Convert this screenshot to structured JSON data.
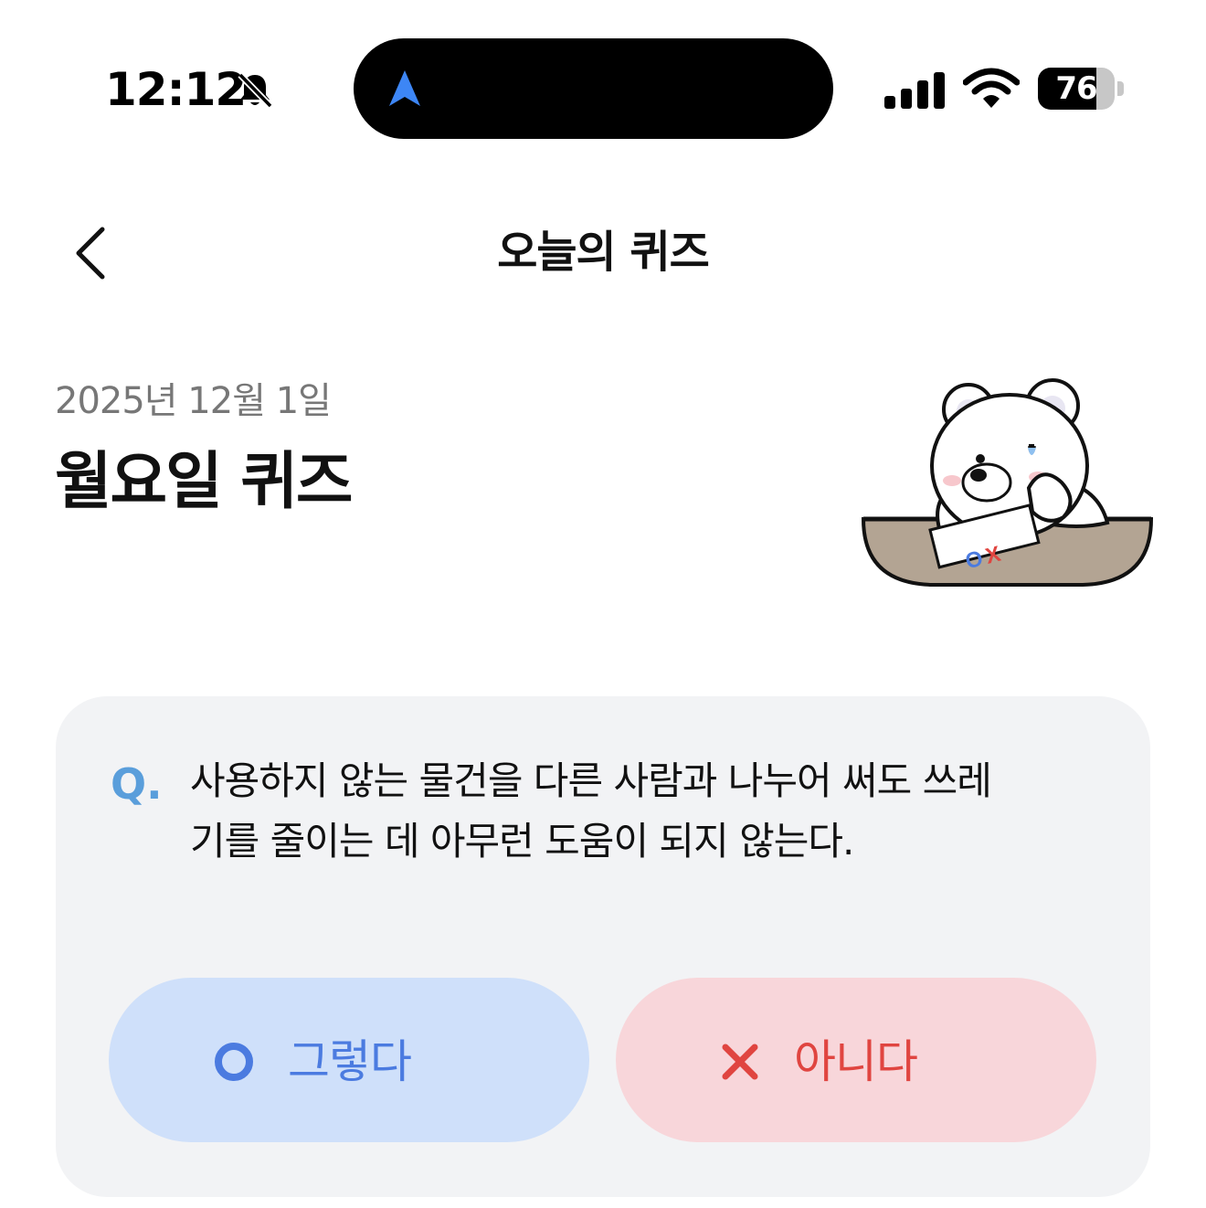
{
  "status_bar": {
    "time": "12:12",
    "battery_percent": "76",
    "battery_level": 0.76
  },
  "header": {
    "title": "오늘의 퀴즈"
  },
  "quiz": {
    "date": "2025년 12월 1일",
    "title": "월요일 퀴즈",
    "question_prefix": "Q.",
    "question": "사용하지 않는 물건을 다른 사람과 나누어 써도 쓰레기를 줄이는 데 아무런 도움이 되지 않는다.",
    "mascot_sign_text": "OX"
  },
  "answers": {
    "yes_label": "그렇다",
    "no_label": "아니다"
  },
  "colors": {
    "yes_bg": "#cfe0fa",
    "yes_accent": "#4b7be0",
    "no_bg": "#f8d6da",
    "no_accent": "#e04540",
    "q_accent": "#5a9edb",
    "card_bg": "#f2f3f5"
  },
  "icons": {
    "status": [
      "bell-slash-icon",
      "navigation-arrow-icon",
      "cellular-signal-icon",
      "wifi-icon",
      "battery-icon"
    ],
    "back": "chevron-left-icon",
    "yes": "circle-o-icon",
    "no": "x-mark-icon"
  }
}
